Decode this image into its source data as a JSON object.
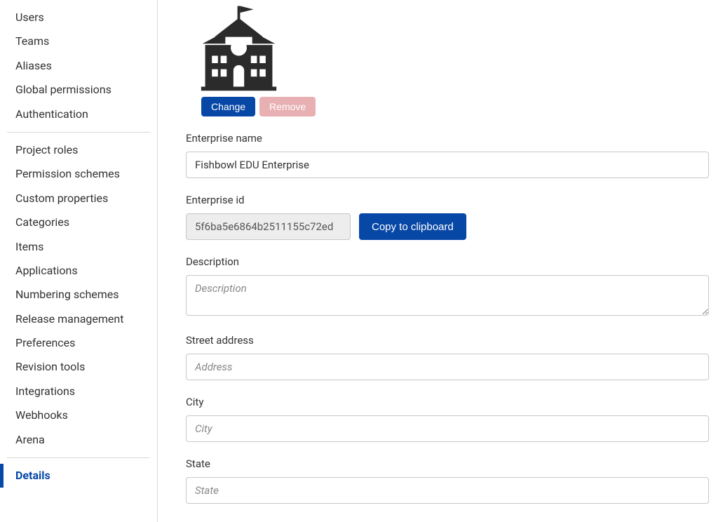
{
  "sidebar": {
    "group1": [
      "Users",
      "Teams",
      "Aliases",
      "Global permissions",
      "Authentication"
    ],
    "group2": [
      "Project roles",
      "Permission schemes",
      "Custom properties",
      "Categories",
      "Items",
      "Applications",
      "Numbering schemes",
      "Release management",
      "Preferences",
      "Revision tools",
      "Integrations",
      "Webhooks",
      "Arena"
    ],
    "group3": [
      "Details"
    ]
  },
  "logo": {
    "change_label": "Change",
    "remove_label": "Remove"
  },
  "form": {
    "enterprise_name": {
      "label": "Enterprise name",
      "value": "Fishbowl EDU Enterprise"
    },
    "enterprise_id": {
      "label": "Enterprise id",
      "value": "5f6ba5e6864b2511155c72ed",
      "copy_label": "Copy to clipboard"
    },
    "description": {
      "label": "Description",
      "placeholder": "Description",
      "value": ""
    },
    "street_address": {
      "label": "Street address",
      "placeholder": "Address",
      "value": ""
    },
    "city": {
      "label": "City",
      "placeholder": "City",
      "value": ""
    },
    "state": {
      "label": "State",
      "placeholder": "State",
      "value": ""
    }
  }
}
